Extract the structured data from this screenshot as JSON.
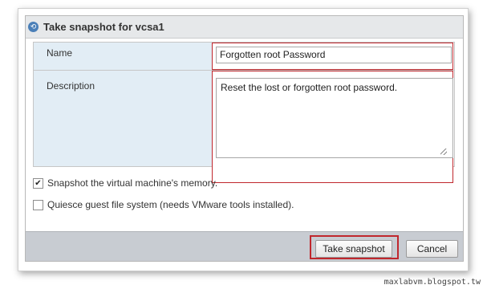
{
  "dialog": {
    "title": "Take snapshot for vcsa1",
    "title_icon": "snapshot-icon"
  },
  "form": {
    "name_label": "Name",
    "name_value": "Forgotten root Password",
    "description_label": "Description",
    "description_value": "Reset the lost or forgotten root password."
  },
  "options": {
    "memory_label": "Snapshot the virtual machine's memory.",
    "memory_checked": true,
    "quiesce_label": "Quiesce guest file system (needs VMware tools installed).",
    "quiesce_checked": false
  },
  "buttons": {
    "take_snapshot": "Take snapshot",
    "cancel": "Cancel"
  },
  "colors": {
    "highlight": "#c0272d",
    "label_bg": "#e2edf5",
    "footer_bg": "#c8ccd2"
  },
  "watermark": "maxlabvm.blogspot.tw"
}
